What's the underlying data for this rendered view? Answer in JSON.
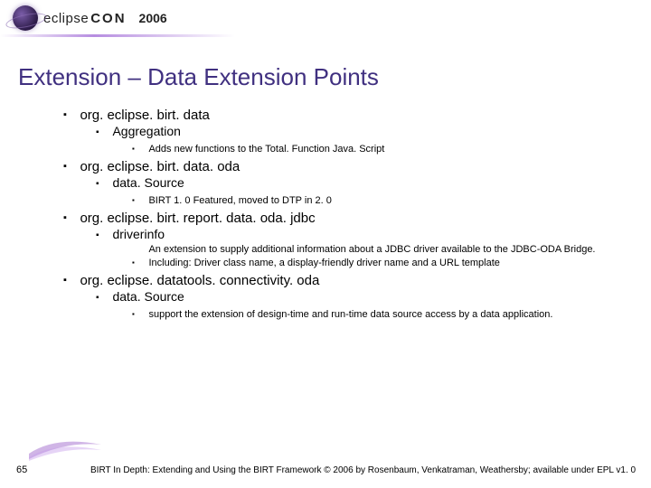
{
  "header": {
    "brand1": "eclipse",
    "brand2": "CON",
    "year": "2006"
  },
  "title": "Extension – Data Extension Points",
  "bullets": [
    {
      "label": "org. eclipse. birt. data",
      "children": [
        {
          "label": "Aggregation",
          "children": [
            {
              "label": "Adds new functions to the Total. Function Java. Script"
            }
          ]
        }
      ]
    },
    {
      "label": "org. eclipse. birt. data. oda",
      "children": [
        {
          "label": "data. Source",
          "children": [
            {
              "label": "BIRT 1. 0 Featured, moved to DTP in 2. 0"
            }
          ]
        }
      ]
    },
    {
      "label": "org. eclipse. birt. report. data. oda. jdbc",
      "children": [
        {
          "label": "driverinfo",
          "children": [
            {
              "label": "An extension to supply additional information about a JDBC driver available to the JDBC-ODA Bridge. Including: Driver class name, a display-friendly driver name and a URL template"
            }
          ]
        }
      ]
    },
    {
      "label": "org. eclipse. datatools. connectivity. oda",
      "children": [
        {
          "label": "data. Source",
          "children": [
            {
              "label": "support the extension of design-time and run-time data source access by a data application."
            }
          ]
        }
      ]
    }
  ],
  "footer": {
    "page": "65",
    "copyright": "BIRT In Depth: Extending and Using the BIRT Framework © 2006 by Rosenbaum, Venkatraman, Weathersby; available under EPL v1. 0"
  }
}
